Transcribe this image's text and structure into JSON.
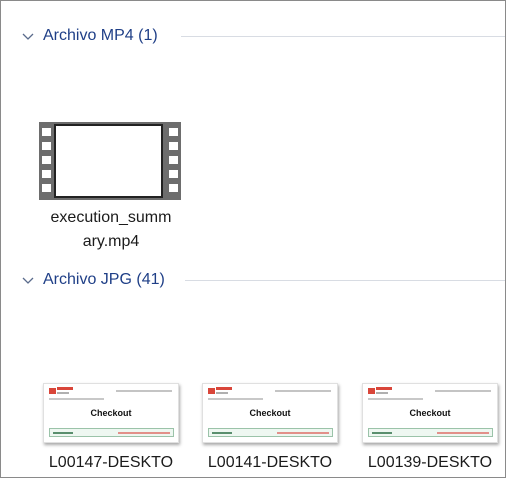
{
  "groups": [
    {
      "title": "Archivo MP4 (1)",
      "files": [
        {
          "name": "execution_summary.mp4",
          "label_line1": "execution_summ",
          "label_line2": "ary.mp4",
          "icon": "video-file-icon"
        }
      ]
    },
    {
      "title": "Archivo JPG (41)",
      "files": [
        {
          "label": "L00147-DESKTO",
          "thumb_title": "Checkout",
          "icon": "image-thumbnail"
        },
        {
          "label": "L00141-DESKTO",
          "thumb_title": "Checkout",
          "icon": "image-thumbnail"
        },
        {
          "label": "L00139-DESKTO",
          "thumb_title": "Checkout",
          "icon": "image-thumbnail"
        }
      ]
    }
  ],
  "colors": {
    "group_title": "#1f3f87",
    "divider": "#d8dce3",
    "brand_red": "#d9463a"
  },
  "icons": {
    "group_toggle": "chevron-down-icon"
  }
}
